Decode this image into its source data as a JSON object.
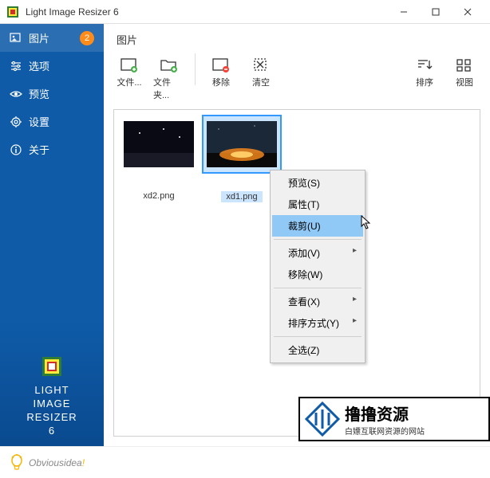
{
  "titlebar": {
    "title": "Light Image Resizer 6"
  },
  "sidebar": {
    "items": [
      {
        "label": "图片",
        "badge": "2"
      },
      {
        "label": "选项"
      },
      {
        "label": "预览"
      },
      {
        "label": "设置"
      },
      {
        "label": "关于"
      }
    ],
    "brand": {
      "l1": "LIGHT",
      "l2": "IMAGE",
      "l3": "RESIZER",
      "l4": "6"
    }
  },
  "content": {
    "header": "图片",
    "toolbar": {
      "files_label": "文件...",
      "folder_label": "文件夹...",
      "remove_label": "移除",
      "clear_label": "清空",
      "sort_label": "排序",
      "view_label": "视图"
    },
    "thumbs": [
      {
        "caption": "xd2.png"
      },
      {
        "caption": "xd1.png"
      }
    ]
  },
  "context_menu": {
    "preview": "预览(S)",
    "properties": "属性(T)",
    "crop": "裁剪(U)",
    "add": "添加(V)",
    "remove": "移除(W)",
    "view": "查看(X)",
    "sort": "排序方式(Y)",
    "select_all": "全选(Z)"
  },
  "footer": {
    "brand_a": "Obvious",
    "brand_b": "idea",
    "brand_c": "!"
  },
  "watermark": {
    "title": "撸撸资源",
    "subtitle": "白嫖互联网资源的网站"
  }
}
